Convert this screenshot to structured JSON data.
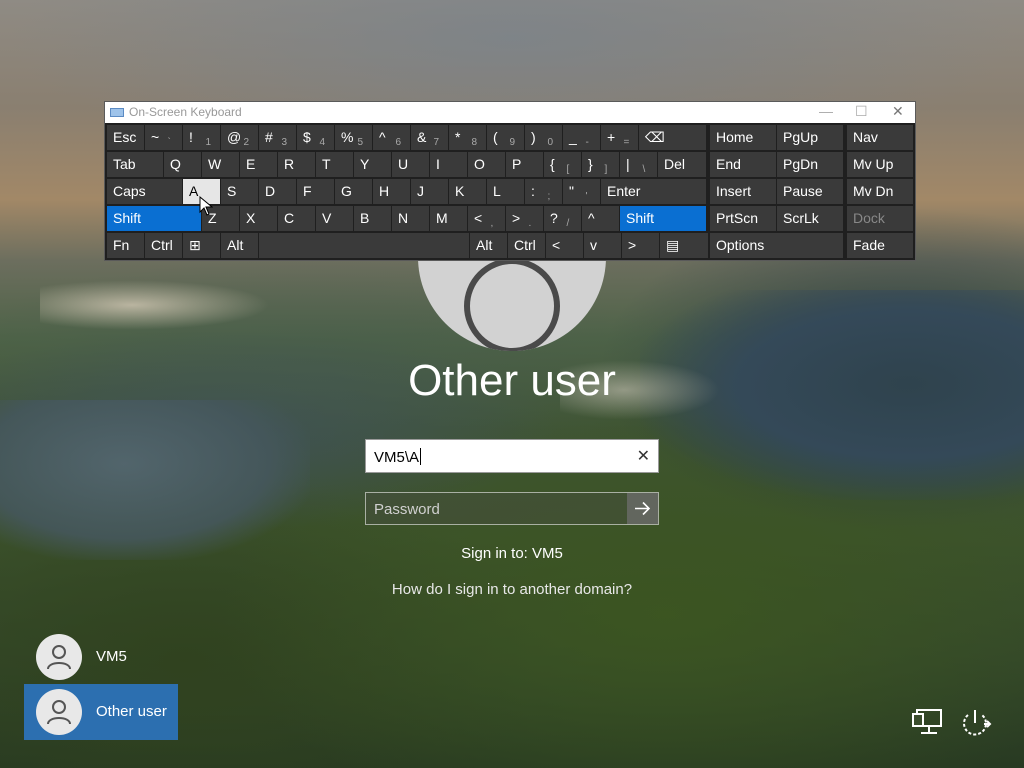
{
  "login": {
    "user_title": "Other user",
    "username_value": "VM5\\A",
    "password_placeholder": "Password",
    "sign_in_to": "Sign in to: VM5",
    "domain_link": "How do I sign in to another domain?",
    "clear_glyph": "✕"
  },
  "users": [
    {
      "name": "VM5",
      "selected": false
    },
    {
      "name": "Other user",
      "selected": true
    }
  ],
  "corner_icons": [
    "network-icon",
    "power-icon"
  ],
  "osk": {
    "title": "On-Screen Keyboard",
    "controls": [
      "—",
      "☐",
      "✕"
    ],
    "row1": [
      {
        "label": "Esc"
      },
      {
        "label": "~",
        "sub": "`"
      },
      {
        "label": "!",
        "sub": "1"
      },
      {
        "label": "@",
        "sub": "2"
      },
      {
        "label": "#",
        "sub": "3"
      },
      {
        "label": "$",
        "sub": "4"
      },
      {
        "label": "%",
        "sub": "5"
      },
      {
        "label": "^",
        "sub": "6"
      },
      {
        "label": "&",
        "sub": "7"
      },
      {
        "label": "*",
        "sub": "8"
      },
      {
        "label": "(",
        "sub": "9"
      },
      {
        "label": ")",
        "sub": "0"
      },
      {
        "label": "_",
        "sub": "-"
      },
      {
        "label": "+",
        "sub": "="
      },
      {
        "label": "⌫"
      }
    ],
    "row2": [
      {
        "label": "Tab"
      },
      {
        "label": "Q"
      },
      {
        "label": "W"
      },
      {
        "label": "E"
      },
      {
        "label": "R"
      },
      {
        "label": "T"
      },
      {
        "label": "Y"
      },
      {
        "label": "U"
      },
      {
        "label": "I"
      },
      {
        "label": "O"
      },
      {
        "label": "P"
      },
      {
        "label": "{",
        "sub": "["
      },
      {
        "label": "}",
        "sub": "]"
      },
      {
        "label": "|",
        "sub": "\\"
      },
      {
        "label": "Del"
      }
    ],
    "row3": [
      {
        "label": "Caps"
      },
      {
        "label": "A"
      },
      {
        "label": "S"
      },
      {
        "label": "D"
      },
      {
        "label": "F"
      },
      {
        "label": "G"
      },
      {
        "label": "H"
      },
      {
        "label": "J"
      },
      {
        "label": "K"
      },
      {
        "label": "L"
      },
      {
        "label": ":",
        "sub": ";"
      },
      {
        "label": "\"",
        "sub": "'"
      },
      {
        "label": "Enter"
      }
    ],
    "row4": [
      {
        "label": "Shift"
      },
      {
        "label": "Z"
      },
      {
        "label": "X"
      },
      {
        "label": "C"
      },
      {
        "label": "V"
      },
      {
        "label": "B"
      },
      {
        "label": "N"
      },
      {
        "label": "M"
      },
      {
        "label": "<",
        "sub": ","
      },
      {
        "label": ">",
        "sub": "."
      },
      {
        "label": "?",
        "sub": "/"
      },
      {
        "label": "^"
      },
      {
        "label": "Shift"
      }
    ],
    "row5": [
      {
        "label": "Fn"
      },
      {
        "label": "Ctrl"
      },
      {
        "label": "⊞"
      },
      {
        "label": "Alt"
      },
      {
        "label": ""
      },
      {
        "label": "Alt"
      },
      {
        "label": "Ctrl"
      },
      {
        "label": "<"
      },
      {
        "label": "v"
      },
      {
        "label": ">"
      },
      {
        "label": "▤"
      }
    ],
    "nav_keys": [
      {
        "label": "Home"
      },
      {
        "label": "PgUp"
      },
      {
        "label": "Nav"
      },
      {
        "label": "End"
      },
      {
        "label": "PgDn"
      },
      {
        "label": "Mv Up"
      },
      {
        "label": "Insert"
      },
      {
        "label": "Pause"
      },
      {
        "label": "Mv Dn"
      },
      {
        "label": "PrtScn"
      },
      {
        "label": "ScrLk"
      },
      {
        "label": "Dock"
      },
      {
        "label": "Options"
      },
      {
        "label": "Fade"
      }
    ],
    "colors": {
      "key": "#3a3a3a",
      "active": "#0a6fd2",
      "pressed": "#e6e6e6"
    }
  }
}
